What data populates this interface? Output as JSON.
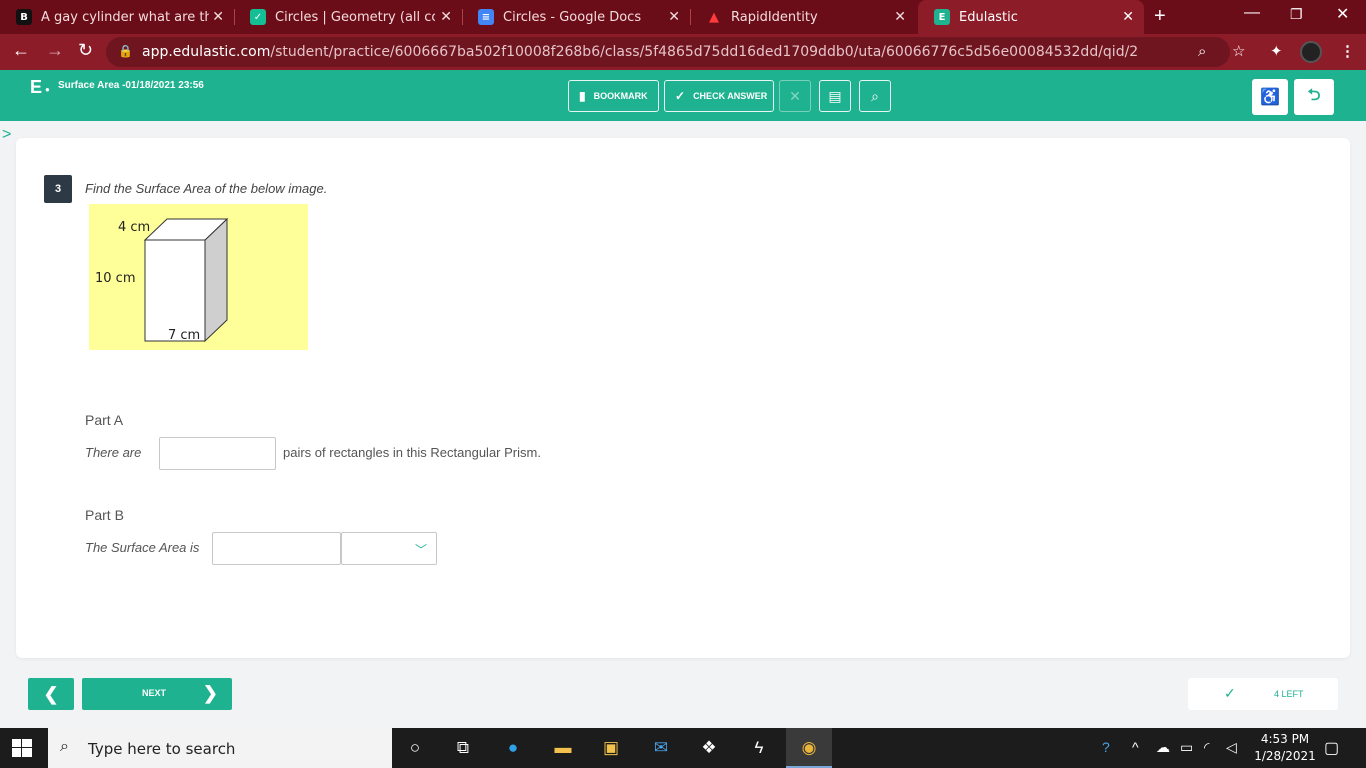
{
  "browser": {
    "tabs": [
      {
        "title": "A gay cylinder what are the var",
        "favicon": "B",
        "favicon_color": "#111111"
      },
      {
        "title": "Circles | Geometry (all content)",
        "favicon": "✓",
        "favicon_color": "#14bf96"
      },
      {
        "title": "Circles - Google Docs",
        "favicon": "≡",
        "favicon_color": "#4285f4"
      },
      {
        "title": "RapidIdentity",
        "favicon": "▲",
        "favicon_color": "#d11f26"
      },
      {
        "title": "Edulastic",
        "favicon": "E",
        "favicon_color": "#1fb290"
      }
    ],
    "url_host": "app.edulastic.com",
    "url_path": "/student/practice/6006667ba502f10008f268b6/class/5f4865d75dd16ded1709ddb0/uta/60066776c5d56e00084532dd/qid/2"
  },
  "app": {
    "logo": "E",
    "assignment_title": "Surface Area -01/18/2021 23:56",
    "toolbar": {
      "bookmark": "BOOKMARK",
      "check_answer": "CHECK ANSWER"
    },
    "accent_color": "#1fb290"
  },
  "question": {
    "number": "3",
    "prompt": "Find the Surface Area of the below image.",
    "figure": {
      "top_label": "4 cm",
      "side_label": "10 cm",
      "bottom_label": "7 cm"
    },
    "part_a": {
      "label": "Part A",
      "prefix": "There are",
      "value": "",
      "suffix": "pairs of rectangles in this Rectangular Prism."
    },
    "part_b": {
      "label": "Part B",
      "prefix": "The Surface Area is",
      "value": "",
      "unit_selected": ""
    }
  },
  "footer": {
    "next": "NEXT",
    "left_count": "4 LEFT"
  },
  "taskbar": {
    "search_placeholder": "Type here to search",
    "time": "4:53 PM",
    "date": "1/28/2021"
  }
}
